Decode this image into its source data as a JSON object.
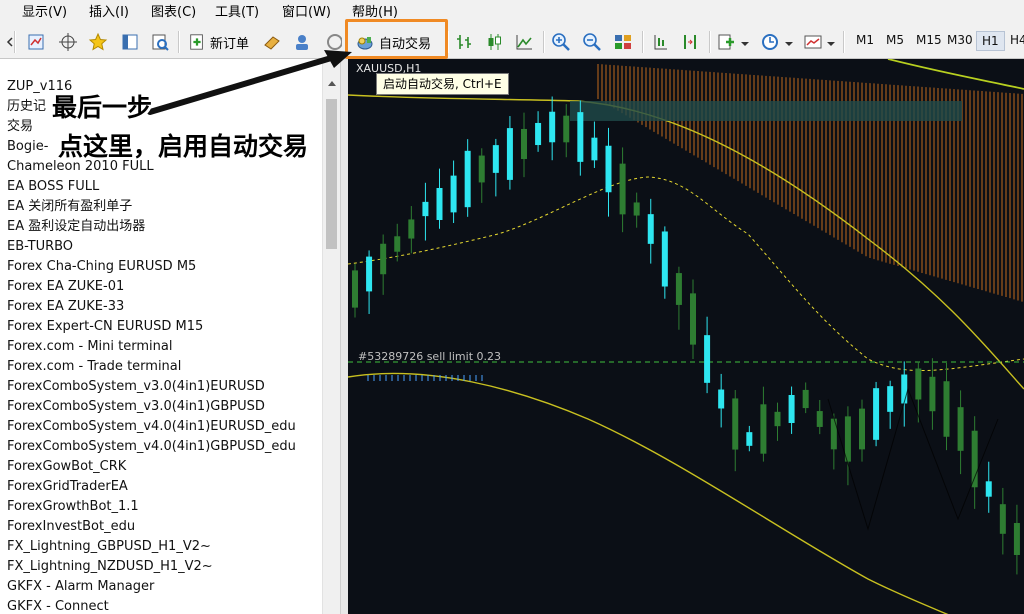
{
  "menu": {
    "items": [
      "显示(V)",
      "插入(I)",
      "图表(C)",
      "工具(T)",
      "窗口(W)",
      "帮助(H)"
    ]
  },
  "toolbar": {
    "new_order_label": "新订单",
    "auto_trading_label": "自动交易",
    "timeframes": [
      "M1",
      "M5",
      "M15",
      "M30",
      "H1",
      "H4"
    ],
    "active_timeframe": "H1",
    "icons": [
      "arrow-left-icon",
      "chart-layout-icon",
      "crosshair-icon",
      "favorites-icon",
      "navigator-icon",
      "tester-icon",
      "new-order-icon",
      "erase-icon",
      "metaeditor-icon",
      "signals-icon",
      "auto-trading-icon",
      "bar-chart-icon",
      "candlestick-icon",
      "line-chart-icon",
      "zoom-in-icon",
      "zoom-out-icon",
      "tile-windows-icon",
      "chart-shift-icon",
      "auto-scroll-icon",
      "indicators-icon",
      "periods-icon",
      "templates-icon"
    ]
  },
  "navigator": {
    "items": [
      "ZUP_v116",
      "历史记",
      "交易",
      "Bogie-",
      "Chameleon 2010 FULL",
      "EA BOSS FULL",
      "EA 关闭所有盈利单子",
      "EA 盈利设定自动出场器",
      "EB-TURBO",
      "Forex Cha-Ching EURUSD M5",
      "Forex EA ZUKE-01",
      "Forex EA ZUKE-33",
      "Forex Expert-CN EURUSD M15",
      "Forex.com - Mini terminal",
      "Forex.com - Trade terminal",
      "ForexComboSystem_v3.0(4in1)EURUSD",
      "ForexComboSystem_v3.0(4in1)GBPUSD",
      "ForexComboSystem_v4.0(4in1)EURUSD_edu",
      "ForexComboSystem_v4.0(4in1)GBPUSD_edu",
      "ForexGowBot_CRK",
      "ForexGridTraderEA",
      "ForexGrowthBot_1.1",
      "ForexInvestBot_edu",
      "FX_Lightning_GBPUSD_H1_V2~",
      "FX_Lightning_NZDUSD_H1_V2~",
      "GKFX - Alarm Manager",
      "GKFX - Connect"
    ]
  },
  "chart": {
    "symbol_label": "XAUUSD,H1",
    "order_label": "#53289726 sell limit 0.23",
    "tooltip": "启动自动交易, Ctrl+E",
    "colors": {
      "background": "#0b0f16",
      "bull": "#2e7d32",
      "bear": "#2ee6f0",
      "band": "#c8c020",
      "ichimoku_cloud": "#e07a1e",
      "ma": "#e6d830",
      "order_line": "#3fbf3f"
    }
  },
  "annotation": {
    "line1": "最后一步",
    "line2": "点这里，启用自动交易",
    "highlight_color": "#f08a24"
  }
}
